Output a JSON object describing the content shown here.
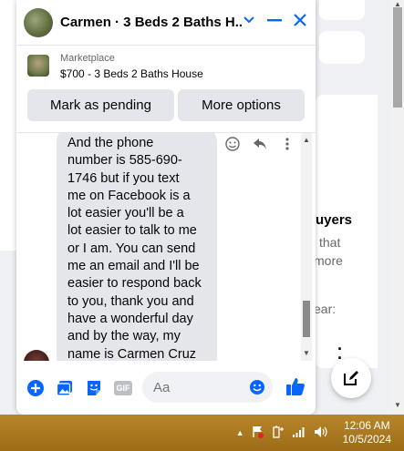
{
  "background": {
    "right_heading": "uyers",
    "right_line1": "that",
    "right_line2": "more",
    "right_line3": "ear:"
  },
  "chat": {
    "title": "Carmen · 3 Beds 2 Baths H...",
    "icons": {
      "chevron": "chevron-down-icon",
      "minimize": "minimize-icon",
      "close": "close-icon"
    },
    "accent": "#0866ff"
  },
  "listing": {
    "label": "Marketplace",
    "value": "$700 - 3 Beds 2 Baths House",
    "buttons": {
      "pending": "Mark as pending",
      "more": "More options"
    }
  },
  "message": {
    "text": "And the phone\nnumber is 585-690-\n1746 but if you text\nme on Facebook is a\nlot easier you'll be a\nlot easier to talk to me\nor I am. You can send\nme an email and I'll be\neasier to respond back\nto you, thank you and\nhave a wonderful day\nand by the way, my\nname is Carmen Cruz"
  },
  "composer": {
    "placeholder": "Aa",
    "gif_label": "GIF"
  },
  "taskbar": {
    "time": "12:06 AM",
    "date": "10/5/2024"
  }
}
